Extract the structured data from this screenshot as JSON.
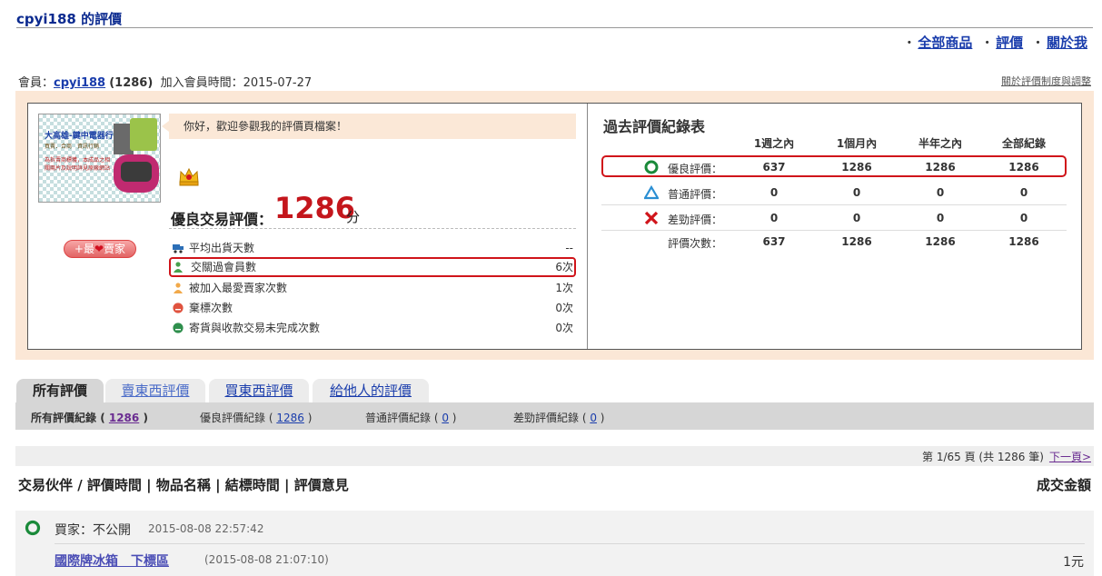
{
  "header": {
    "title": "cpyi188 的評價"
  },
  "top_nav": [
    "全部商品",
    "評價",
    "關於我"
  ],
  "member": {
    "prefix": "會員：",
    "username": "cpyi188",
    "count": "(1286)",
    "joined_label": "加入會員時間：",
    "joined_date": "2015-07-27",
    "rules_link": "關於評價制度與調整"
  },
  "banner": {
    "name": "大高雄-鍵中電器行",
    "sub": "買賣．合商　資訊行銷",
    "desc": "為拆賣商標獲，本成品之相關兩片及說明詳見原廠網站"
  },
  "fav_seller": {
    "label_pre": "+最",
    "label_post": "賣家"
  },
  "welcome": "你好，歡迎參觀我的評價頁檔案！",
  "score": {
    "label": "優良交易評價：",
    "value": "1286",
    "unit": "分"
  },
  "stats": [
    {
      "label": "平均出貨天數",
      "value": "--",
      "icon": "truck-icon",
      "highlighted": false
    },
    {
      "label": "交關過會員數",
      "value": "6次",
      "icon": "member-green-icon",
      "highlighted": true
    },
    {
      "label": "被加入最愛賣家次數",
      "value": "1次",
      "icon": "member-orange-icon",
      "highlighted": false
    },
    {
      "label": "棄標次數",
      "value": "0次",
      "icon": "sad-red-face-icon",
      "highlighted": false
    },
    {
      "label": "寄貨與收款交易未完成次數",
      "value": "0次",
      "icon": "sad-green-face-icon",
      "highlighted": false
    }
  ],
  "history": {
    "title": "過去評價紀錄表",
    "columns": [
      "1週之內",
      "1個月內",
      "半年之內",
      "全部紀錄"
    ],
    "rows": [
      {
        "label": "優良評價：",
        "icon": "good-circle-icon",
        "values": [
          "637",
          "1286",
          "1286",
          "1286"
        ],
        "highlighted": true
      },
      {
        "label": "普通評價：",
        "icon": "normal-triangle-icon",
        "values": [
          "0",
          "0",
          "0",
          "0"
        ],
        "highlighted": false
      },
      {
        "label": "差勁評價：",
        "icon": "bad-x-icon",
        "values": [
          "0",
          "0",
          "0",
          "0"
        ],
        "highlighted": false
      },
      {
        "label": "評價次數：",
        "icon": "",
        "values": [
          "637",
          "1286",
          "1286",
          "1286"
        ],
        "highlighted": false
      }
    ]
  },
  "tabs": [
    "所有評價",
    "賣東西評價",
    "買東西評價",
    "給他人的評價"
  ],
  "subfilters": [
    {
      "label": "所有評價紀錄",
      "count": "1286"
    },
    {
      "label": "優良評價紀錄",
      "count": "1286"
    },
    {
      "label": "普通評價紀錄",
      "count": "0"
    },
    {
      "label": "差勁評價紀錄",
      "count": "0"
    }
  ],
  "pager": {
    "text": "第 1/65 頁 (共 1286 筆)",
    "next": "下一頁>"
  },
  "list_header": {
    "left": "交易伙伴 / 評價時間 | 物品名稱 | 結標時間 | 評價意見",
    "right": "成交金額"
  },
  "entry": {
    "buyer": "買家：不公開",
    "buyer_time": "2015-08-08 22:57:42",
    "item": "國際牌冰箱　下標區",
    "item_time": "(2015-08-08 21:07:10)",
    "amount": "1元"
  },
  "colors": {
    "accent_red": "#c4161c",
    "link_blue": "#1a3dac",
    "peach": "#fbe7d6",
    "good_green": "#1a8a3a",
    "normal_blue": "#2b8fd3"
  }
}
